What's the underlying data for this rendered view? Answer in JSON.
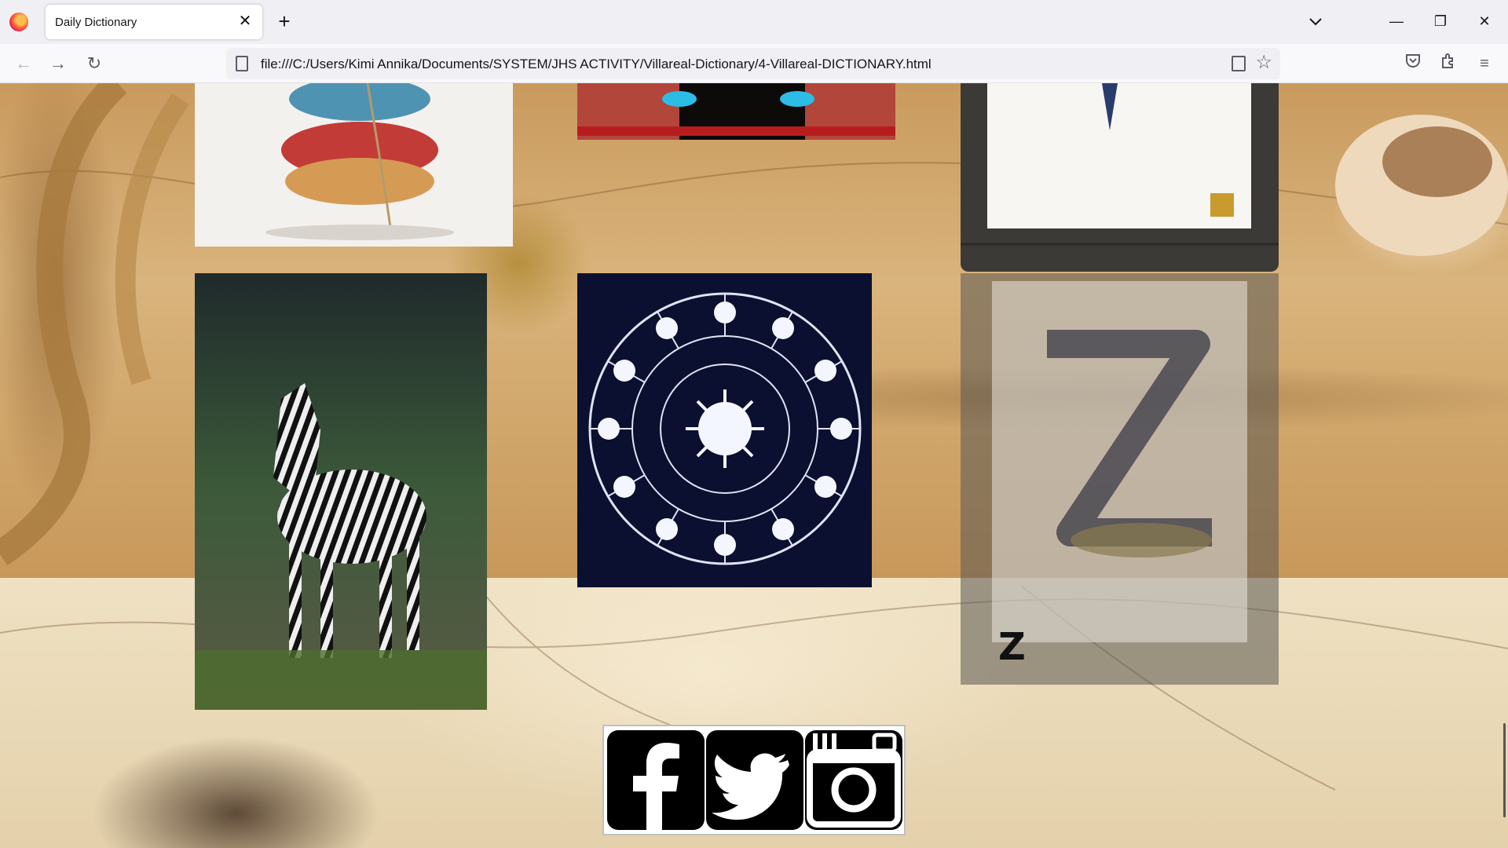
{
  "browser": {
    "tab_title": "Daily Dictionary",
    "url": "file:///C:/Users/Kimi Annika/Documents/SYSTEM/JHS ACTIVITY/Villareal-Dictionary/4-Villareal-DICTIONARY.html",
    "new_tab_glyph": "+",
    "close_glyph": "✕",
    "back_glyph": "←",
    "forward_glyph": "→",
    "reload_glyph": "↻",
    "minimize_glyph": "—",
    "restore_glyph": "❐",
    "window_close_glyph": "✕",
    "star_glyph": "☆",
    "menu_glyph": "≡",
    "tab_list_glyph": "⌄"
  },
  "page": {
    "letter_caption": "Z",
    "images": [
      {
        "subject": "stacked wooden yo-yo toy"
      },
      {
        "subject": "red shoes with glowing lights"
      },
      {
        "subject": "letter art print on wood"
      },
      {
        "subject": "baby zebra"
      },
      {
        "subject": "zodiac wheel"
      },
      {
        "subject": "floral letter Z art"
      }
    ],
    "social": [
      "facebook",
      "twitter",
      "instagram"
    ]
  },
  "colors": {
    "tabbar": "#f0f0f4",
    "navbar": "#f9f9fb",
    "zodiac_bg": "#0b1030",
    "social_black": "#000000"
  }
}
